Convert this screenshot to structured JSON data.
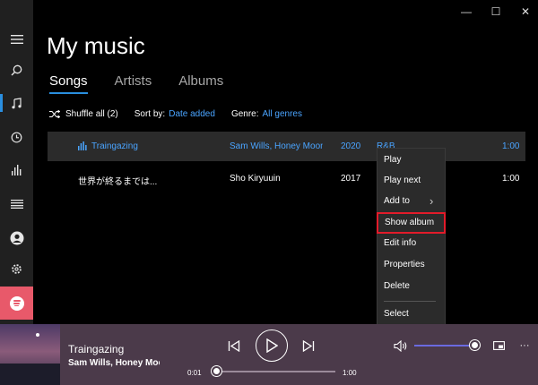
{
  "window": {
    "minimize": "—",
    "maximize": "☐",
    "close": "✕"
  },
  "rail": [
    {
      "name": "hamburger-menu-icon",
      "glyph": "☰"
    },
    {
      "name": "search-icon",
      "glyph": "⌕"
    },
    {
      "name": "music-note-icon",
      "glyph": "♫"
    },
    {
      "name": "recent-clock-icon",
      "glyph": "◷"
    },
    {
      "name": "now-playing-bars-icon",
      "glyph": "▮"
    },
    {
      "name": "playlist-icon",
      "glyph": "≡"
    },
    {
      "name": "account-icon",
      "glyph": "●"
    },
    {
      "name": "settings-icon",
      "glyph": "⚙"
    }
  ],
  "title": "My music",
  "tabs": [
    {
      "label": "Songs"
    },
    {
      "label": "Artists"
    },
    {
      "label": "Albums"
    }
  ],
  "filters": {
    "shuffle": "Shuffle all (2)",
    "sort_label": "Sort by:",
    "sort_value": "Date added",
    "genre_label": "Genre:",
    "genre_value": "All genres"
  },
  "songs": [
    {
      "title": "Traingazing",
      "artist": "Sam Wills, Honey Moon",
      "year": "2020",
      "genre": "R&B",
      "duration": "1:00"
    },
    {
      "title": "世界が終るまでは...",
      "artist": "Sho Kiryuuin",
      "year": "2017",
      "genre": "",
      "duration": "1:00"
    }
  ],
  "context_menu": {
    "play": "Play",
    "play_next": "Play next",
    "add_to": "Add to",
    "add_to_arrow": "›",
    "show_album": "Show album",
    "edit_info": "Edit info",
    "properties": "Properties",
    "delete": "Delete",
    "select": "Select"
  },
  "player": {
    "track_title": "Traingazing",
    "track_artist": "Sam Wills, Honey Moon",
    "elapsed": "0:01",
    "total": "1:00",
    "progress": 0.017,
    "volume": 0.95,
    "more": "···"
  },
  "colors": {
    "accent": "#2a8fe0",
    "link": "#4aa4ff",
    "player_bg": "#4b3a4a",
    "highlight_box": "#e21b2a"
  }
}
